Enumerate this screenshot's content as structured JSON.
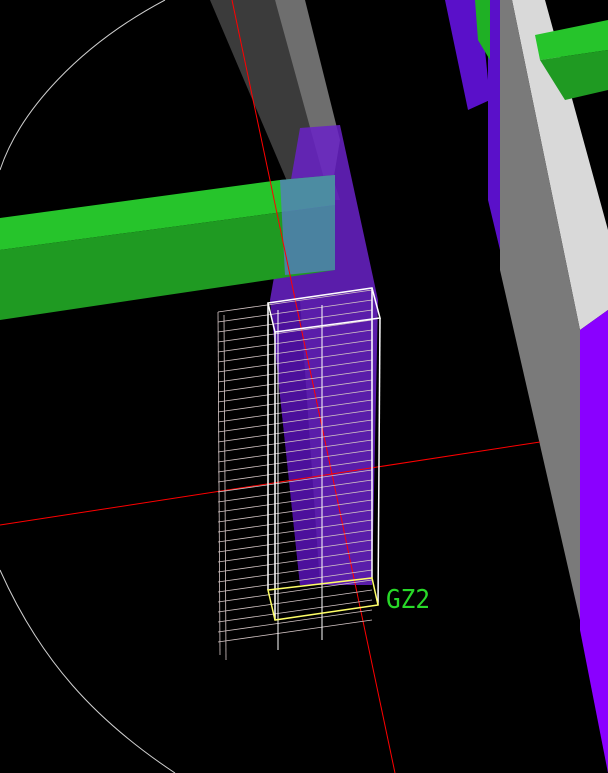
{
  "viewport": {
    "background": "#000000"
  },
  "colors": {
    "beam_green_top": "#26c42b",
    "beam_green_side": "#1f9a22",
    "column_grey_dark": "#3a3a3a",
    "column_grey_light": "#6e6e6e",
    "wall_grey_light": "#d9d9d9",
    "wall_grey_mid": "#7a7a7a",
    "purple_dark": "#5a10c9",
    "purple_bright": "#8a00ff",
    "selection_white": "#ffffff",
    "selection_yellow": "#ffff66",
    "rebar_lines": "#d6c7c7",
    "axis_red": "#ff0000",
    "circle": "#d0d0d0",
    "label_green": "#28d828"
  },
  "labels": {
    "element_id": "GZ2"
  }
}
